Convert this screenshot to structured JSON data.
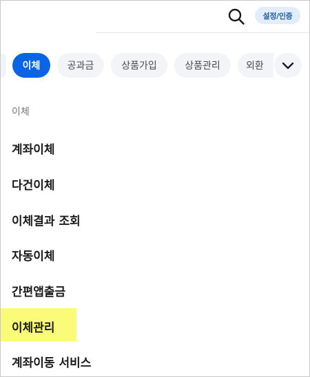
{
  "header": {
    "search_icon": "search-icon",
    "settings_label": "설정/인증"
  },
  "tabs": {
    "items": [
      {
        "label": "이체",
        "active": true
      },
      {
        "label": "공과금",
        "active": false
      },
      {
        "label": "상품가입",
        "active": false
      },
      {
        "label": "상품관리",
        "active": false
      },
      {
        "label": "외환",
        "active": false
      }
    ],
    "more_icon": "chevron-down-icon"
  },
  "section": {
    "label": "이체",
    "items": [
      {
        "label": "계좌이체"
      },
      {
        "label": "다건이체"
      },
      {
        "label": "이체결과 조회"
      },
      {
        "label": "자동이체"
      },
      {
        "label": "간편앱출금"
      },
      {
        "label": "이체관리",
        "highlighted": true,
        "highlight_color": "#fbfb7a"
      },
      {
        "label": "계좌이동 서비스"
      }
    ]
  },
  "colors": {
    "accent": "#0a64e6",
    "chip_bg": "#f2f4f7",
    "settings_bg": "#e3edf9",
    "settings_text": "#1f5fa8"
  }
}
